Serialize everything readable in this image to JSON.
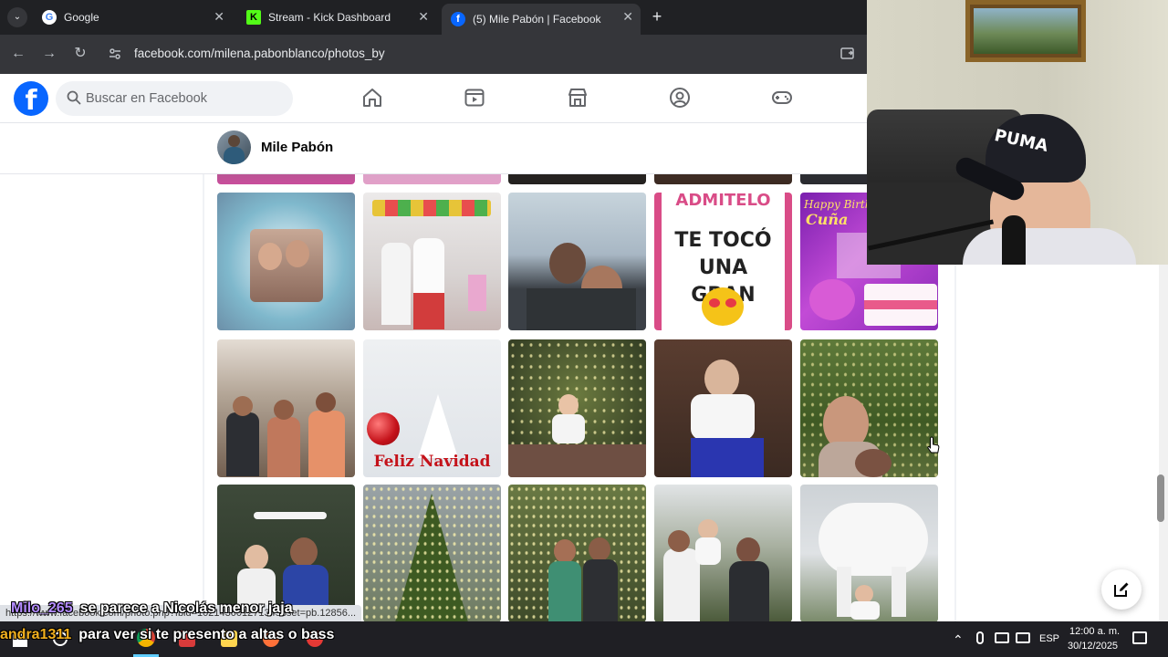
{
  "browser": {
    "tabs": [
      {
        "title": "Google",
        "favicon": "google-icon",
        "active": false
      },
      {
        "title": "Stream - Kick Dashboard",
        "favicon": "kick-icon",
        "active": false
      },
      {
        "title": "(5) Mile Pabón | Facebook",
        "favicon": "facebook-icon",
        "active": true
      }
    ],
    "new_tab_label": "+",
    "url": "facebook.com/milena.pabonblanco/photos_by"
  },
  "facebook": {
    "logo": "f",
    "search_placeholder": "Buscar en Facebook",
    "nav_icons": [
      "home-icon",
      "video-icon",
      "marketplace-icon",
      "groups-icon",
      "gaming-icon"
    ],
    "profile_name": "Mile Pabón"
  },
  "photos": {
    "row1_texts": {
      "admitelo_top": "ADMITELO",
      "admitelo_main": "TE TOCÓ UNA GRAN",
      "birthday": "Cuña",
      "birthday_script": "Happy Birth"
    },
    "row2_texts": {
      "christmas": "Feliz Navidad"
    }
  },
  "status_url": "https://www.facebook.com/photo.php?fbid=1021430012713458set=pb.12856...",
  "chat": [
    {
      "user": "Milo_265",
      "message": "se parece a Nicolás menor jaja",
      "user_color": "#b48cff"
    },
    {
      "user": "andra1311",
      "message": "para ver si te presento a altas o bass",
      "user_color": "#f2b01e"
    }
  ],
  "tray": {
    "language": "ESP",
    "time": "12:00 a. m.",
    "date": "30/12/2025"
  },
  "colors": {
    "facebook_blue": "#0866ff",
    "browser_dark": "#202124"
  }
}
